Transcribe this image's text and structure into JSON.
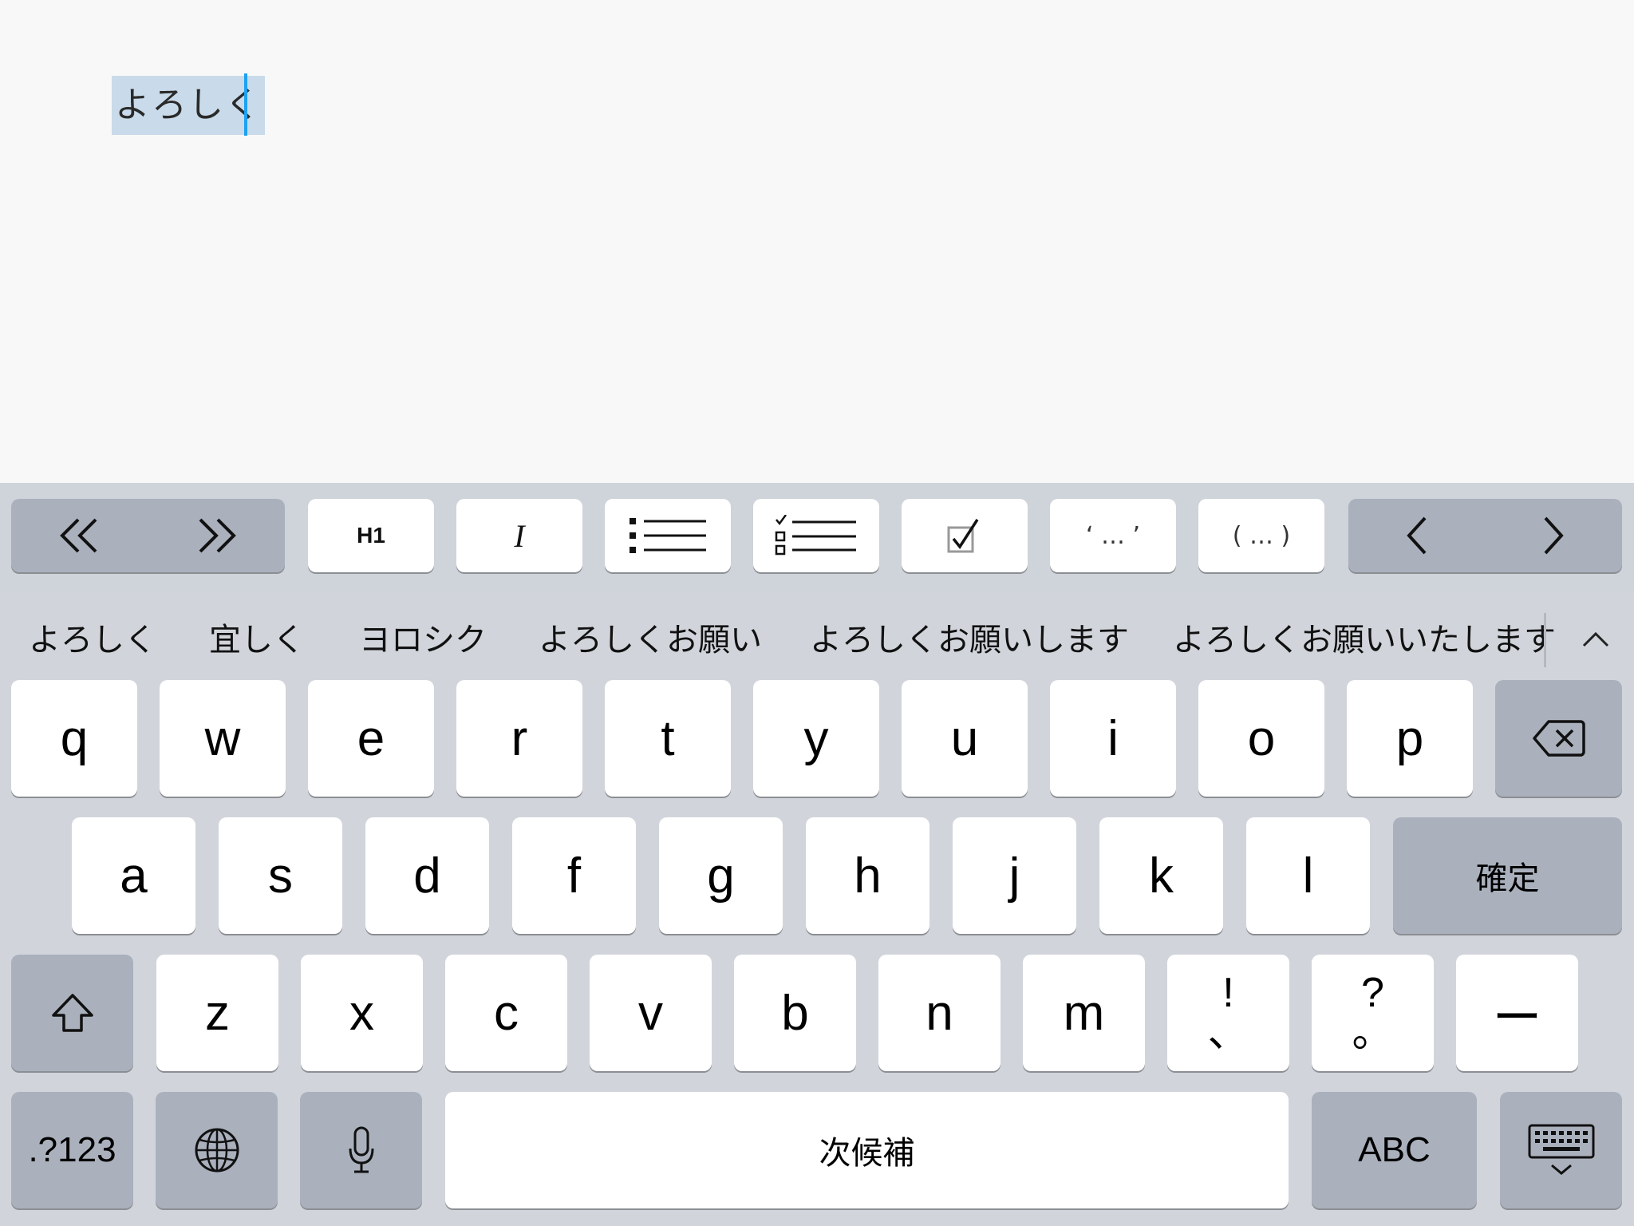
{
  "editor": {
    "composing_text": "よろしく"
  },
  "toolbar": {
    "prev_nav": "«",
    "next_nav": "»",
    "heading_label": "H1",
    "italic_label": "I",
    "bullet_list_icon": "bullet-list-icon",
    "checklist_icon": "checklist-icon",
    "checkbox_icon": "checkbox-icon",
    "quote_label": "‘ … ’",
    "paren_label": "( … )",
    "cursor_left": "<",
    "cursor_right": ">"
  },
  "candidates": [
    "よろしく",
    "宜しく",
    "ヨロシク",
    "よろしくお願い",
    "よろしくお願いします",
    "よろしくお願いいたします"
  ],
  "keyboard": {
    "row1": [
      "q",
      "w",
      "e",
      "r",
      "t",
      "y",
      "u",
      "i",
      "o",
      "p"
    ],
    "row2": [
      "a",
      "s",
      "d",
      "f",
      "g",
      "h",
      "j",
      "k",
      "l"
    ],
    "row3": [
      "z",
      "x",
      "c",
      "v",
      "b",
      "n",
      "m"
    ],
    "confirm_label": "確定",
    "exclaim_top": "!",
    "exclaim_bottom": "、",
    "question_top": "?",
    "question_bottom": "。",
    "dash_label": "ー",
    "numbers_label": ".?123",
    "space_label": "次候補",
    "abc_label": "ABC"
  },
  "colors": {
    "selection": "#c9dbea",
    "caret": "#1ea1f2",
    "key_light": "#ffffff",
    "key_dark": "#aab1bd",
    "keyboard_bg": "#d1d5db"
  }
}
